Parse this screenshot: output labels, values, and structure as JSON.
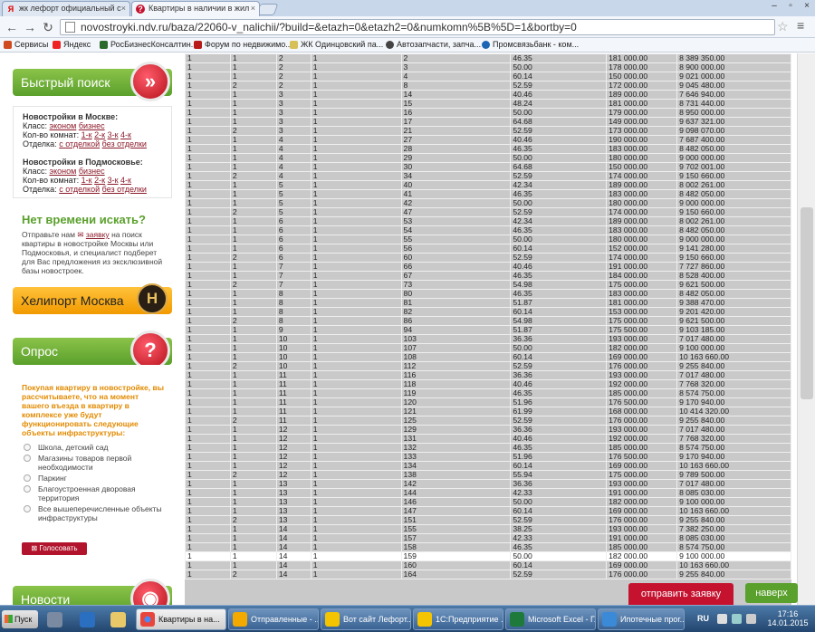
{
  "browser": {
    "tabs": [
      {
        "label": "жк лефорт официальный с",
        "icon": "yandex-favicon"
      },
      {
        "label": "Квартиры в наличии в жил",
        "icon": "ndv-favicon"
      }
    ],
    "url": "novostroyki.ndv.ru/baza/22060-v_nalichii/?build=&etazh=0&etazh2=0&numkomn%5B%5D=1&bortby=0",
    "bookmarks": [
      "Сервисы",
      "Яндекс",
      "РосБизнесКонсалтин...",
      "Форум по недвижимо...",
      "ЖК Одинцовский па...",
      "Автозапчасти, запча...",
      "Промсвязьбанк - ком..."
    ]
  },
  "sidebar": {
    "quick_search": {
      "title": "Быстрый поиск",
      "moscow_heading": "Новостройки в Москве:",
      "oblast_heading": "Новостройки в Подмосковье:",
      "class_label": "Класс:",
      "class_options": [
        "эконом",
        "бизнес"
      ],
      "rooms_label": "Кол-во комнат:",
      "rooms_options": [
        "1-к",
        "2-к",
        "3-к",
        "4-к"
      ],
      "finish_label": "Отделка:",
      "finish_options": [
        "с отделкой",
        "без отделки"
      ]
    },
    "no_time": {
      "title": "Нет времени искать?",
      "text_before": "Отправьте нам",
      "link": "заявку",
      "text_after": "на поиск квартиры в новостройке Москвы или Подмосковья, и специалист подберет для Вас предложения из эксклюзивной базы новостроек."
    },
    "heliport": {
      "title": "Хелипорт Москва",
      "logo_letter": "H"
    },
    "poll": {
      "title": "Опрос",
      "question": "Покупая квартиру в новостройке, вы рассчитываете, что на момент вашего въезда в квартиру в комплексе уже будут функционировать следующие объекты инфраструктуры:",
      "options": [
        "Школа, детский сад",
        "Магазины товаров первой необходимости",
        "Паркинг",
        "Благоустроенная дворовая территория",
        "Все вышеперечисленные объекты инфраструктуры"
      ],
      "vote_label": "Голосовать"
    },
    "news": {
      "title": "Новости"
    }
  },
  "table": {
    "rows": [
      [
        "1",
        "1",
        "2",
        "1",
        "2",
        "46.35",
        "181 000.00",
        "8 389 350.00"
      ],
      [
        "1",
        "1",
        "2",
        "1",
        "3",
        "50.00",
        "178 000.00",
        "8 900 000.00"
      ],
      [
        "1",
        "1",
        "2",
        "1",
        "4",
        "60.14",
        "150 000.00",
        "9 021 000.00"
      ],
      [
        "1",
        "2",
        "2",
        "1",
        "8",
        "52.59",
        "172 000.00",
        "9 045 480.00"
      ],
      [
        "1",
        "1",
        "3",
        "1",
        "14",
        "40.46",
        "189 000.00",
        "7 646 940.00"
      ],
      [
        "1",
        "1",
        "3",
        "1",
        "15",
        "48.24",
        "181 000.00",
        "8 731 440.00"
      ],
      [
        "1",
        "1",
        "3",
        "1",
        "16",
        "50.00",
        "179 000.00",
        "8 950 000.00"
      ],
      [
        "1",
        "1",
        "3",
        "1",
        "17",
        "64.68",
        "149 000.00",
        "9 637 321.00"
      ],
      [
        "1",
        "2",
        "3",
        "1",
        "21",
        "52.59",
        "173 000.00",
        "9 098 070.00"
      ],
      [
        "1",
        "1",
        "4",
        "1",
        "27",
        "40.46",
        "190 000.00",
        "7 687 400.00"
      ],
      [
        "1",
        "1",
        "4",
        "1",
        "28",
        "46.35",
        "183 000.00",
        "8 482 050.00"
      ],
      [
        "1",
        "1",
        "4",
        "1",
        "29",
        "50.00",
        "180 000.00",
        "9 000 000.00"
      ],
      [
        "1",
        "1",
        "4",
        "1",
        "30",
        "64.68",
        "150 000.00",
        "9 702 001.00"
      ],
      [
        "1",
        "2",
        "4",
        "1",
        "34",
        "52.59",
        "174 000.00",
        "9 150 660.00"
      ],
      [
        "1",
        "1",
        "5",
        "1",
        "40",
        "42.34",
        "189 000.00",
        "8 002 261.00"
      ],
      [
        "1",
        "1",
        "5",
        "1",
        "41",
        "46.35",
        "183 000.00",
        "8 482 050.00"
      ],
      [
        "1",
        "1",
        "5",
        "1",
        "42",
        "50.00",
        "180 000.00",
        "9 000 000.00"
      ],
      [
        "1",
        "2",
        "5",
        "1",
        "47",
        "52.59",
        "174 000.00",
        "9 150 660.00"
      ],
      [
        "1",
        "1",
        "6",
        "1",
        "53",
        "42.34",
        "189 000.00",
        "8 002 261.00"
      ],
      [
        "1",
        "1",
        "6",
        "1",
        "54",
        "46.35",
        "183 000.00",
        "8 482 050.00"
      ],
      [
        "1",
        "1",
        "6",
        "1",
        "55",
        "50.00",
        "180 000.00",
        "9 000 000.00"
      ],
      [
        "1",
        "1",
        "6",
        "1",
        "56",
        "60.14",
        "152 000.00",
        "9 141 280.00"
      ],
      [
        "1",
        "2",
        "6",
        "1",
        "60",
        "52.59",
        "174 000.00",
        "9 150 660.00"
      ],
      [
        "1",
        "1",
        "7",
        "1",
        "66",
        "40.46",
        "191 000.00",
        "7 727 860.00"
      ],
      [
        "1",
        "1",
        "7",
        "1",
        "67",
        "46.35",
        "184 000.00",
        "8 528 400.00"
      ],
      [
        "1",
        "2",
        "7",
        "1",
        "73",
        "54.98",
        "175 000.00",
        "9 621 500.00"
      ],
      [
        "1",
        "1",
        "8",
        "1",
        "80",
        "46.35",
        "183 000.00",
        "8 482 050.00"
      ],
      [
        "1",
        "1",
        "8",
        "1",
        "81",
        "51.87",
        "181 000.00",
        "9 388 470.00"
      ],
      [
        "1",
        "1",
        "8",
        "1",
        "82",
        "60.14",
        "153 000.00",
        "9 201 420.00"
      ],
      [
        "1",
        "2",
        "8",
        "1",
        "86",
        "54.98",
        "175 000.00",
        "9 621 500.00"
      ],
      [
        "1",
        "1",
        "9",
        "1",
        "94",
        "51.87",
        "175 500.00",
        "9 103 185.00"
      ],
      [
        "1",
        "1",
        "10",
        "1",
        "103",
        "36.36",
        "193 000.00",
        "7 017 480.00"
      ],
      [
        "1",
        "1",
        "10",
        "1",
        "107",
        "50.00",
        "182 000.00",
        "9 100 000.00"
      ],
      [
        "1",
        "1",
        "10",
        "1",
        "108",
        "60.14",
        "169 000.00",
        "10 163 660.00"
      ],
      [
        "1",
        "2",
        "10",
        "1",
        "112",
        "52.59",
        "176 000.00",
        "9 255 840.00"
      ],
      [
        "1",
        "1",
        "11",
        "1",
        "116",
        "36.36",
        "193 000.00",
        "7 017 480.00"
      ],
      [
        "1",
        "1",
        "11",
        "1",
        "118",
        "40.46",
        "192 000.00",
        "7 768 320.00"
      ],
      [
        "1",
        "1",
        "11",
        "1",
        "119",
        "46.35",
        "185 000.00",
        "8 574 750.00"
      ],
      [
        "1",
        "1",
        "11",
        "1",
        "120",
        "51.96",
        "176 500.00",
        "9 170 940.00"
      ],
      [
        "1",
        "1",
        "11",
        "1",
        "121",
        "61.99",
        "168 000.00",
        "10 414 320.00"
      ],
      [
        "1",
        "2",
        "11",
        "1",
        "125",
        "52.59",
        "176 000.00",
        "9 255 840.00"
      ],
      [
        "1",
        "1",
        "12",
        "1",
        "129",
        "36.36",
        "193 000.00",
        "7 017 480.00"
      ],
      [
        "1",
        "1",
        "12",
        "1",
        "131",
        "40.46",
        "192 000.00",
        "7 768 320.00"
      ],
      [
        "1",
        "1",
        "12",
        "1",
        "132",
        "46.35",
        "185 000.00",
        "8 574 750.00"
      ],
      [
        "1",
        "1",
        "12",
        "1",
        "133",
        "51.96",
        "176 500.00",
        "9 170 940.00"
      ],
      [
        "1",
        "1",
        "12",
        "1",
        "134",
        "60.14",
        "169 000.00",
        "10 163 660.00"
      ],
      [
        "1",
        "2",
        "12",
        "1",
        "138",
        "55.94",
        "175 000.00",
        "9 789 500.00"
      ],
      [
        "1",
        "1",
        "13",
        "1",
        "142",
        "36.36",
        "193 000.00",
        "7 017 480.00"
      ],
      [
        "1",
        "1",
        "13",
        "1",
        "144",
        "42.33",
        "191 000.00",
        "8 085 030.00"
      ],
      [
        "1",
        "1",
        "13",
        "1",
        "146",
        "50.00",
        "182 000.00",
        "9 100 000.00"
      ],
      [
        "1",
        "1",
        "13",
        "1",
        "147",
        "60.14",
        "169 000.00",
        "10 163 660.00"
      ],
      [
        "1",
        "2",
        "13",
        "1",
        "151",
        "52.59",
        "176 000.00",
        "9 255 840.00"
      ],
      [
        "1",
        "1",
        "14",
        "1",
        "155",
        "38.25",
        "193 000.00",
        "7 382 250.00"
      ],
      [
        "1",
        "1",
        "14",
        "1",
        "157",
        "42.33",
        "191 000.00",
        "8 085 030.00"
      ],
      [
        "1",
        "1",
        "14",
        "1",
        "158",
        "46.35",
        "185 000.00",
        "8 574 750.00"
      ],
      [
        "1",
        "1",
        "14",
        "1",
        "159",
        "50.00",
        "182 000.00",
        "9 100 000.00"
      ],
      [
        "1",
        "1",
        "14",
        "1",
        "160",
        "60.14",
        "169 000.00",
        "10 163 660.00"
      ],
      [
        "1",
        "2",
        "14",
        "1",
        "164",
        "52.59",
        "176 000.00",
        "9 255 840.00"
      ]
    ],
    "highlighted_row": 55
  },
  "floating": {
    "send_request": "отправить заявку",
    "to_top": "наверх"
  },
  "taskbar": {
    "start": "Пуск",
    "items": [
      {
        "label": "Квартиры в на...",
        "icon": "chrome-icon",
        "active": true
      },
      {
        "label": "Отправленные - ...",
        "icon": "outlook-icon",
        "active": false
      },
      {
        "label": "Вот сайт Лефорт...",
        "icon": "mail-icon",
        "active": false
      },
      {
        "label": "1С:Предприятие ...",
        "icon": "1c-icon",
        "active": false
      },
      {
        "label": "Microsoft Excel - Г...",
        "icon": "excel-icon",
        "active": false
      },
      {
        "label": "Ипотечные прог...",
        "icon": "ie-icon",
        "active": false
      }
    ],
    "lang": "RU",
    "time": "17:16",
    "date": "14.01.2015"
  },
  "colors": {
    "green": "#5aa02c",
    "red": "#c4122f",
    "orange": "#f29a00",
    "link": "#8b1a2a"
  }
}
